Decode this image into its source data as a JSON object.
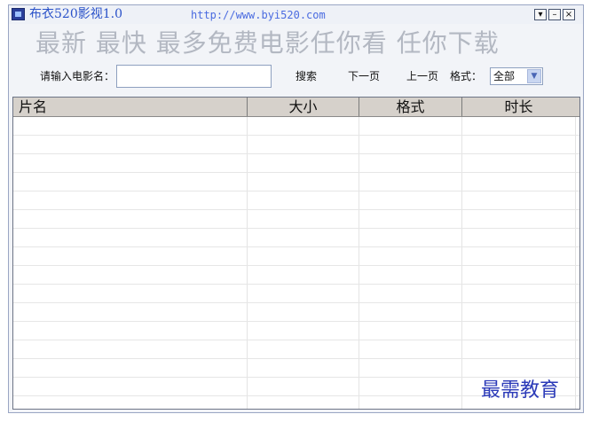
{
  "window": {
    "title": "布衣520影视1.0",
    "url": "http://www.byi520.com",
    "buttons": {
      "minimize": "▾",
      "restore": "–",
      "close": "×"
    }
  },
  "slogan": "最新 最快 最多免费电影任你看 任你下载",
  "search": {
    "label": "请输入电影名：",
    "value": "",
    "placeholder": ""
  },
  "toolbar": {
    "search_label": "搜索",
    "next_label": "下一页",
    "prev_label": "上一页",
    "format_label": "格式：",
    "format_value": "全部"
  },
  "table": {
    "columns": [
      "片名",
      "大小",
      "格式",
      "时长"
    ],
    "rows": []
  },
  "watermark": "最需教育",
  "colors": {
    "title_blue": "#2a52c9",
    "slogan_gray": "#b3b8c2",
    "header_bg": "#d6d1cb",
    "watermark_blue": "#2b3ab8"
  }
}
